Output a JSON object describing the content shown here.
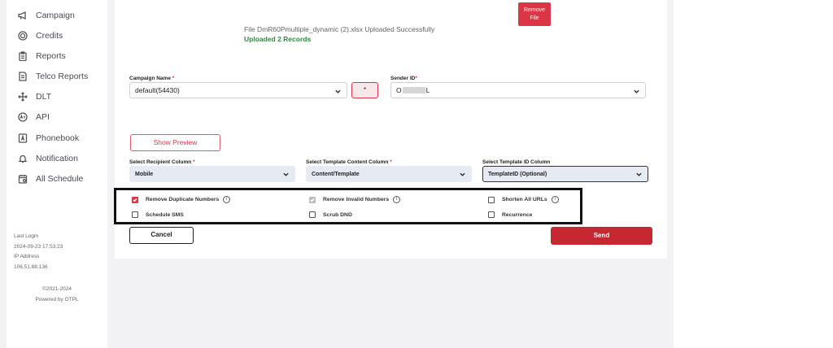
{
  "sidebar": {
    "items": [
      {
        "label": "Campaign",
        "icon": "megaphone-icon"
      },
      {
        "label": "Credits",
        "icon": "coin-icon"
      },
      {
        "label": "Reports",
        "icon": "clipboard-icon"
      },
      {
        "label": "Telco Reports",
        "icon": "document-icon"
      },
      {
        "label": "DLT",
        "icon": "move-icon"
      },
      {
        "label": "API",
        "icon": "api-icon"
      },
      {
        "label": "Phonebook",
        "icon": "phonebook-icon"
      },
      {
        "label": "Notification",
        "icon": "bell-icon"
      },
      {
        "label": "All Schedule",
        "icon": "calendar-icon"
      }
    ],
    "last_login_label": "Last Login",
    "last_login_value": "2024-09-23 17:53:23",
    "ip_label": "IP Address",
    "ip_value": "106.51.88.136",
    "copyright": "©2021-2024",
    "powered_by": "Powered by OTPL"
  },
  "upload": {
    "remove_file_label": "Remove File",
    "message": "File DmR60Pmultiple_dynamic (2).xlsx Uploaded Successfully",
    "records": "Uploaded 2 Records"
  },
  "form": {
    "campaign_name_label": "Campaign Name",
    "campaign_name_value": "default(54430)",
    "star_button": "*",
    "sender_id_label": "Sender ID",
    "sender_id_value_start": "O",
    "sender_id_value_end": "L",
    "required_mark": "*",
    "show_preview_label": "Show Preview",
    "recipient_column_label": "Select Recipient Column",
    "recipient_column_value": "Mobile",
    "template_content_label": "Select Template Content Column",
    "template_content_value": "Content/Template",
    "template_id_label": "Select Template ID Column",
    "template_id_value": "TemplateID (Optional)"
  },
  "options": {
    "remove_duplicates": "Remove Duplicate Numbers",
    "remove_invalid": "Remove Invalid Numbers",
    "shorten_urls": "Shorten All URLs",
    "schedule_sms": "Schedule SMS",
    "scrub_dnd": "Scrub DND",
    "recurrence": "Recurrence",
    "info_glyph": "i"
  },
  "actions": {
    "cancel": "Cancel",
    "send": "Send"
  },
  "colors": {
    "accent": "#dc3545",
    "success": "#2e8b3e",
    "select_bg": "#e6ebf3"
  }
}
